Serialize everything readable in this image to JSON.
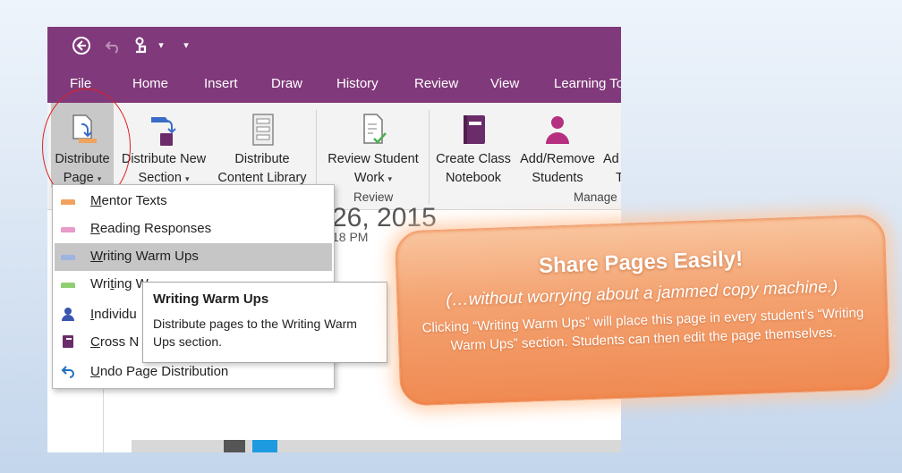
{
  "qat": {
    "back_icon": "back-circle-icon",
    "undo_icon": "undo-icon",
    "touch_icon": "touch-mode-icon",
    "touch_arrow": "▾",
    "customize": "▾"
  },
  "tabs": [
    "File",
    "Home",
    "Insert",
    "Draw",
    "History",
    "Review",
    "View",
    "Learning To"
  ],
  "ribbon": {
    "distribute_page": {
      "line1": "Distribute",
      "line2": "Page"
    },
    "distribute_new_section": {
      "line1": "Distribute New",
      "line2": "Section"
    },
    "distribute_content_library": {
      "line1": "Distribute",
      "line2": "Content Library"
    },
    "review_student_work": {
      "line1": "Review Student",
      "line2": "Work"
    },
    "create_class_notebook": {
      "line1": "Create Class",
      "line2": "Notebook"
    },
    "add_remove_students": {
      "line1": "Add/Remove",
      "line2": "Students"
    },
    "add_teachers_partial": {
      "line1": "Ad",
      "line2": "T"
    },
    "group_review": "Review",
    "group_manage": "Manage"
  },
  "page": {
    "date_partial": "26, 2015",
    "time_partial": "18 PM"
  },
  "dropdown": {
    "items": [
      {
        "prefix": "",
        "u": "M",
        "rest": "entor Texts",
        "color": "#f0a35e"
      },
      {
        "prefix": "",
        "u": "R",
        "rest": "eading Responses",
        "color": "#e99bc9"
      },
      {
        "prefix": "",
        "u": "W",
        "rest": "riting Warm Ups",
        "color": "#9db4e0"
      },
      {
        "prefix": "Wri",
        "u": "t",
        "rest": "ing W",
        "color": "#8fcf72"
      },
      {
        "prefix": "",
        "u": "I",
        "rest": "ndividu",
        "color": "#3a55b0"
      },
      {
        "prefix": "",
        "u": "C",
        "rest": "ross N",
        "color": "#6b2c6a"
      },
      {
        "prefix": "",
        "u": "U",
        "rest": "ndo Page Distribution",
        "color": "#1f6fc5"
      }
    ]
  },
  "tooltip": {
    "title": "Writing Warm Ups",
    "description": "Distribute pages to the Writing Warm Ups section."
  },
  "callout": {
    "title": "Share Pages Easily!",
    "subtitle": "(…without worrying about a jammed copy machine.)",
    "body": "Clicking “Writing Warm Ups” will place this page in every student’s “Writing Warm Ups” section. Students can then edit the page themselves."
  }
}
